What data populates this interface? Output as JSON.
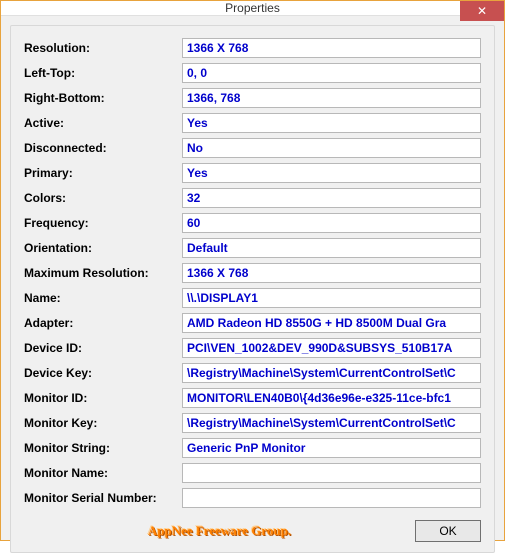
{
  "window": {
    "title": "Properties",
    "close_glyph": "✕"
  },
  "props": [
    {
      "label": "Resolution:",
      "value": "1366 X 768"
    },
    {
      "label": "Left-Top:",
      "value": "0, 0"
    },
    {
      "label": "Right-Bottom:",
      "value": "1366, 768"
    },
    {
      "label": "Active:",
      "value": "Yes"
    },
    {
      "label": "Disconnected:",
      "value": "No"
    },
    {
      "label": "Primary:",
      "value": "Yes"
    },
    {
      "label": "Colors:",
      "value": "32"
    },
    {
      "label": "Frequency:",
      "value": "60"
    },
    {
      "label": "Orientation:",
      "value": "Default"
    },
    {
      "label": "Maximum Resolution:",
      "value": "1366 X 768"
    },
    {
      "label": "Name:",
      "value": "\\\\.\\DISPLAY1"
    },
    {
      "label": "Adapter:",
      "value": "AMD Radeon HD 8550G + HD 8500M Dual Gra"
    },
    {
      "label": "Device ID:",
      "value": "PCI\\VEN_1002&DEV_990D&SUBSYS_510B17A"
    },
    {
      "label": "Device Key:",
      "value": "\\Registry\\Machine\\System\\CurrentControlSet\\C"
    },
    {
      "label": "Monitor ID:",
      "value": "MONITOR\\LEN40B0\\{4d36e96e-e325-11ce-bfc1"
    },
    {
      "label": "Monitor Key:",
      "value": "\\Registry\\Machine\\System\\CurrentControlSet\\C"
    },
    {
      "label": "Monitor String:",
      "value": "Generic PnP Monitor"
    },
    {
      "label": "Monitor Name:",
      "value": ""
    },
    {
      "label": "Monitor Serial Number:",
      "value": ""
    }
  ],
  "footer": {
    "credit": "AppNee Freeware Group.",
    "ok": "OK"
  }
}
